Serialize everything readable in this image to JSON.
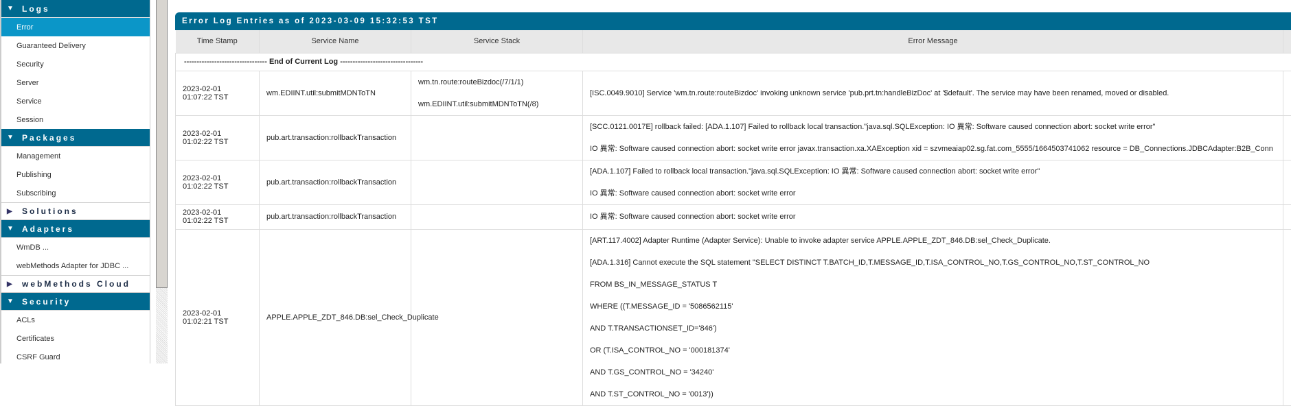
{
  "sidebar": {
    "logs": {
      "title": "Logs",
      "items": [
        "Error",
        "Guaranteed Delivery",
        "Security",
        "Server",
        "Service",
        "Session"
      ]
    },
    "packages": {
      "title": "Packages",
      "items": [
        "Management",
        "Publishing",
        "Subscribing"
      ]
    },
    "solutions": {
      "title": "Solutions"
    },
    "adapters": {
      "title": "Adapters",
      "items": [
        "WmDB ...",
        "webMethods Adapter for JDBC ..."
      ]
    },
    "cloud": {
      "title": "webMethods Cloud"
    },
    "security": {
      "title": "Security",
      "items": [
        "ACLs",
        "Certificates",
        "CSRF Guard"
      ]
    }
  },
  "main": {
    "title": "Error Log Entries as of 2023-03-09 15:32:53 TST",
    "columns": [
      "Time Stamp",
      "Service Name",
      "Service Stack",
      "Error Message"
    ],
    "end_of_log": "--------------------------------- End of Current Log ---------------------------------",
    "rows": [
      {
        "time": "2023-02-01 01:07:22 TST",
        "service": "wm.EDIINT.util:submitMDNToTN",
        "stack": [
          "wm.tn.route:routeBizdoc(/7/1/1)",
          "wm.EDIINT.util:submitMDNToTN(/8)"
        ],
        "message": [
          "[ISC.0049.9010] Service 'wm.tn.route:routeBizdoc' invoking unknown service 'pub.prt.tn:handleBizDoc' at '$default'. The service may have been renamed, moved or disabled."
        ]
      },
      {
        "time": "2023-02-01 01:02:22 TST",
        "service": "pub.art.transaction:rollbackTransaction",
        "stack": [],
        "message": [
          "[SCC.0121.0017E] rollback failed: [ADA.1.107] Failed to rollback local transaction.\"java.sql.SQLException: IO 異常: Software caused connection abort: socket write error\"",
          "IO 異常: Software caused connection abort: socket write error javax.transaction.xa.XAException xid = szvmeaiap02.sg.fat.com_5555/1664503741062 resource = DB_Connections.JDBCAdapter:B2B_Conn"
        ]
      },
      {
        "time": "2023-02-01 01:02:22 TST",
        "service": "pub.art.transaction:rollbackTransaction",
        "stack": [],
        "message": [
          "[ADA.1.107] Failed to rollback local transaction.\"java.sql.SQLException: IO 異常: Software caused connection abort: socket write error\"",
          "IO 異常: Software caused connection abort: socket write error"
        ]
      },
      {
        "time": "2023-02-01 01:02:22 TST",
        "service": "pub.art.transaction:rollbackTransaction",
        "stack": [],
        "message": [
          "IO 異常: Software caused connection abort: socket write error"
        ]
      },
      {
        "time": "2023-02-01 01:02:21 TST",
        "service": "APPLE.APPLE_ZDT_846.DB:sel_Check_Duplicate",
        "stack": [],
        "message": [
          "[ART.117.4002] Adapter Runtime (Adapter Service): Unable to invoke adapter service APPLE.APPLE_ZDT_846.DB:sel_Check_Duplicate.",
          "[ADA.1.316] Cannot execute the SQL statement \"SELECT DISTINCT T.BATCH_ID,T.MESSAGE_ID,T.ISA_CONTROL_NO,T.GS_CONTROL_NO,T.ST_CONTROL_NO",
          "FROM BS_IN_MESSAGE_STATUS T",
          "WHERE ((T.MESSAGE_ID = '5086562115'",
          "AND T.TRANSACTIONSET_ID='846')",
          "OR (T.ISA_CONTROL_NO = '000181374'",
          "AND T.GS_CONTROL_NO = '34240'",
          "AND T.ST_CONTROL_NO = '0013'))"
        ]
      }
    ]
  }
}
